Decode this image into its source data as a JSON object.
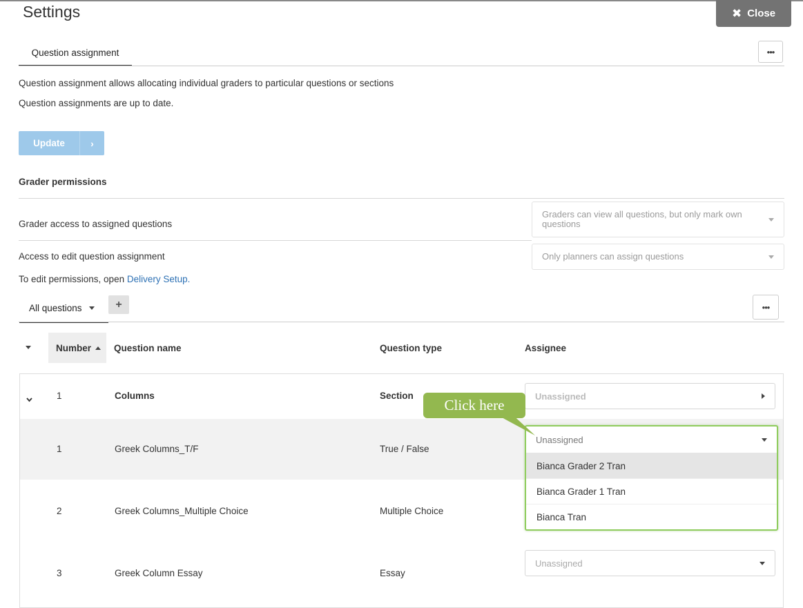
{
  "header": {
    "title": "Settings",
    "close_label": "Close"
  },
  "tabs": {
    "active": "Question assignment"
  },
  "more_icon": "•••",
  "assignment": {
    "description": "Question assignment allows allocating individual graders to particular questions or sections",
    "status": "Question assignments are up to date.",
    "update_label": "Update",
    "update_arrow": "›"
  },
  "permissions": {
    "heading": "Grader permissions",
    "rows": [
      {
        "label": "Grader access to assigned questions",
        "value": "Graders can view all questions, but only mark own questions"
      },
      {
        "label": "Access to edit question assignment",
        "value": "Only planners can assign questions"
      }
    ],
    "note_prefix": "To edit permissions, open ",
    "note_link": "Delivery Setup."
  },
  "question_tabs": {
    "active": "All questions",
    "add_label": "+"
  },
  "table": {
    "headers": {
      "number": "Number",
      "name": "Question name",
      "type": "Question type",
      "assignee": "Assignee"
    },
    "rows": [
      {
        "number": "1",
        "name": "Columns",
        "type": "Section",
        "assignee": "Unassigned",
        "is_section": true
      },
      {
        "number": "1",
        "name": "Greek Columns_T/F",
        "type": "True / False",
        "assignee": "Unassigned"
      },
      {
        "number": "2",
        "name": "Greek Columns_Multiple Choice",
        "type": "Multiple Choice",
        "assignee": ""
      },
      {
        "number": "3",
        "name": "Greek Column Essay",
        "type": "Essay",
        "assignee": "Unassigned"
      }
    ]
  },
  "dropdown": {
    "options": [
      "Bianca Grader 2 Tran",
      "Bianca Grader 1 Tran",
      "Bianca Tran"
    ],
    "highlighted_index": 0
  },
  "callout": {
    "text": "Click here"
  },
  "colors": {
    "accent_link": "#2f72b5",
    "update_button": "#9ec9ea",
    "dropdown_border": "#8fcc5d",
    "callout": "#93b84f",
    "close_button": "#737373"
  }
}
